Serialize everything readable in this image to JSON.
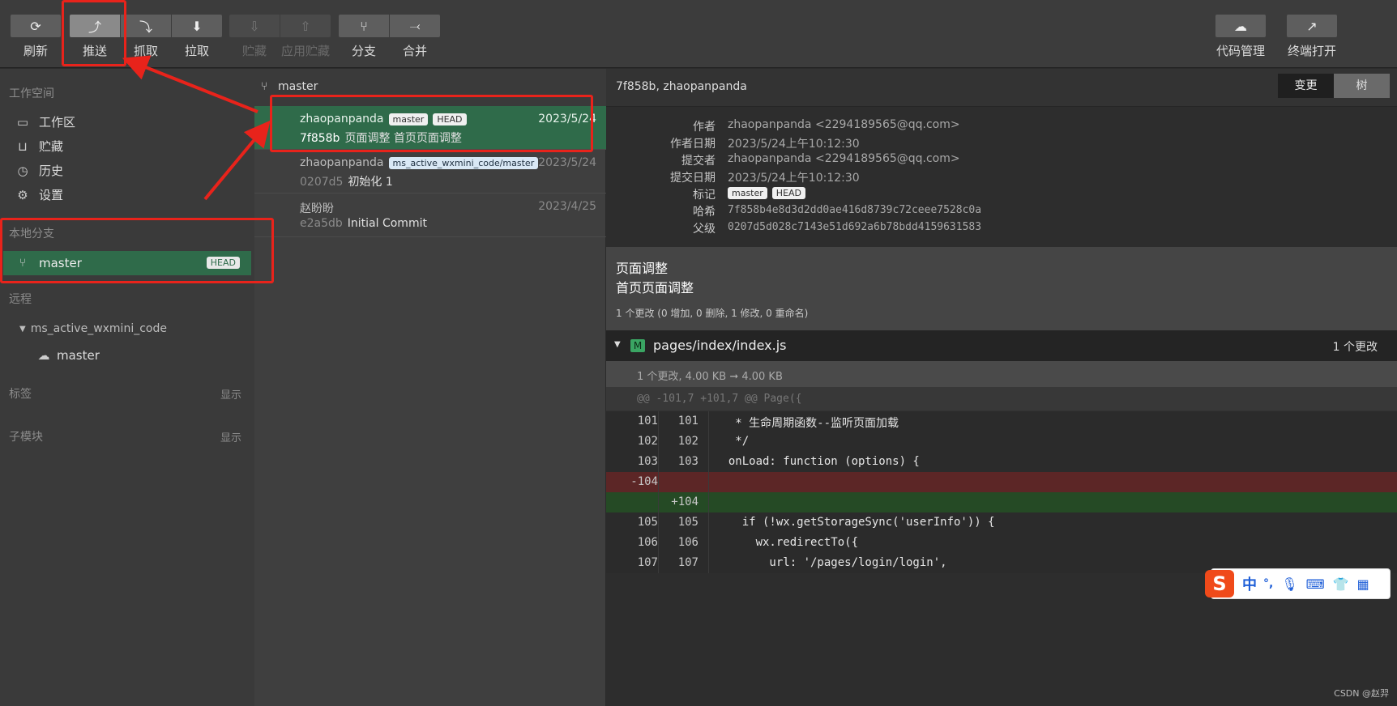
{
  "toolbar": {
    "refresh": "刷新",
    "push": "推送",
    "fetch": "抓取",
    "pull": "拉取",
    "stash": "贮藏",
    "apply_stash": "应用贮藏",
    "branch": "分支",
    "merge": "合并",
    "repo_mgmt": "代码管理",
    "terminal": "终端打开"
  },
  "sidebar": {
    "workspace_title": "工作空间",
    "items": [
      {
        "label": "工作区",
        "icon": "folder-icon"
      },
      {
        "label": "贮藏",
        "icon": "stash-icon"
      },
      {
        "label": "历史",
        "icon": "history-icon"
      },
      {
        "label": "设置",
        "icon": "gear-icon"
      }
    ],
    "local_branches_title": "本地分支",
    "local_branch": "master",
    "head_badge": "HEAD",
    "remote_title": "远程",
    "remote_name": "ms_active_wxmini_code",
    "remote_branch": "master",
    "tags_title": "标签",
    "tags_show": "显示",
    "submodules_title": "子模块",
    "submodules_show": "显示"
  },
  "commit_list": {
    "branch": "master",
    "commits": [
      {
        "author": "zhaopanpanda",
        "tags": [
          "master",
          "HEAD"
        ],
        "date": "2023/5/24",
        "hash": "7f858b",
        "message": "页面调整 首页页面调整"
      },
      {
        "author": "zhaopanpanda",
        "tags": [
          "ms_active_wxmini_code/master"
        ],
        "date": "2023/5/24",
        "hash": "0207d5",
        "message": "初始化 1"
      },
      {
        "author": "赵盼盼",
        "tags": [],
        "date": "2023/4/25",
        "hash": "e2a5db",
        "message": "Initial Commit"
      }
    ]
  },
  "detail": {
    "header": "7f858b, zhaopanpanda",
    "view_change": "变更",
    "view_tree": "树",
    "author_label": "作者",
    "author": "zhaopanpanda <2294189565@qq.com>",
    "author_date_label": "作者日期",
    "author_date": "2023/5/24上午10:12:30",
    "committer_label": "提交者",
    "committer": "zhaopanpanda <2294189565@qq.com>",
    "commit_date_label": "提交日期",
    "commit_date": "2023/5/24上午10:12:30",
    "refs_label": "标记",
    "refs": [
      "master",
      "HEAD"
    ],
    "sha_label": "哈希",
    "sha": "7f858b4e8d3d2dd0ae416d8739c72ceee7528c0a",
    "parent_label": "父级",
    "parent": "0207d5d028c7143e51d692a6b78bdd4159631583",
    "message_line1": "页面调整",
    "message_line2": "首页页面调整",
    "summary": "1 个更改 (0 增加, 0 删除, 1 修改, 0 重命名)",
    "file_status": "M",
    "file_path": "pages/index/index.js",
    "file_changes": "1 个更改",
    "size_info": "1 个更改, 4.00 KB ➞ 4.00 KB",
    "hunk": "@@ -101,7 +101,7 @@ Page({",
    "lines": [
      {
        "old": "101",
        "new": "101",
        "type": "ctx",
        "code": "   * 生命周期函数--监听页面加载"
      },
      {
        "old": "102",
        "new": "102",
        "type": "ctx",
        "code": "   */"
      },
      {
        "old": "103",
        "new": "103",
        "type": "ctx",
        "code": "  onLoad: function (options) {"
      },
      {
        "old": "-104",
        "new": "",
        "type": "del",
        "code": ""
      },
      {
        "old": "",
        "new": "+104",
        "type": "add",
        "code": ""
      },
      {
        "old": "105",
        "new": "105",
        "type": "ctx",
        "code": "    if (!wx.getStorageSync('userInfo')) {"
      },
      {
        "old": "106",
        "new": "106",
        "type": "ctx",
        "code": "      wx.redirectTo({"
      },
      {
        "old": "107",
        "new": "107",
        "type": "ctx",
        "code": "        url: '/pages/login/login',"
      }
    ]
  },
  "ime": {
    "lang": "中",
    "punct": "°,"
  },
  "watermark": "CSDN @赵羿",
  "colors": {
    "accent_green": "#2f6b4a",
    "annotation_red": "#e8231b",
    "del_bg": "#5c2626",
    "add_bg": "#254a25"
  }
}
